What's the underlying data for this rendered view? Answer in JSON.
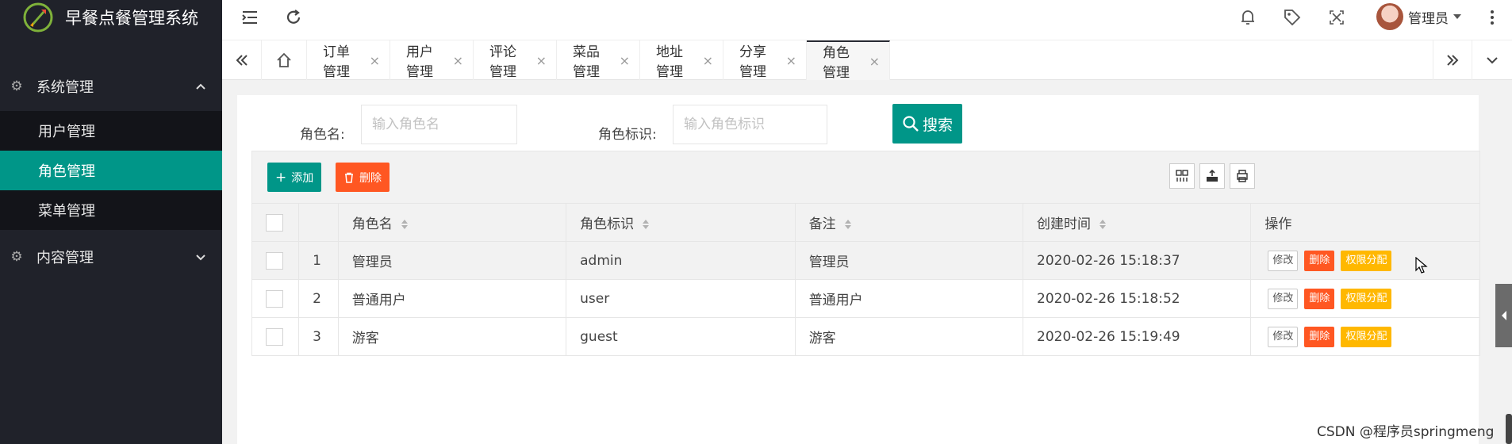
{
  "app": {
    "title": "早餐点餐管理系统"
  },
  "sidebar": {
    "groups": [
      {
        "label": "系统管理",
        "icon": "gear-icon",
        "expanded": true,
        "items": [
          {
            "label": "用户管理"
          },
          {
            "label": "角色管理",
            "active": true
          },
          {
            "label": "菜单管理"
          }
        ]
      },
      {
        "label": "内容管理",
        "icon": "gear-icon",
        "expanded": false
      }
    ]
  },
  "header": {
    "user_name": "管理员",
    "icons": [
      "menu-toggle-icon",
      "refresh-icon",
      "bell-icon",
      "tag-icon",
      "fullscreen-icon",
      "more-icon"
    ]
  },
  "tabs": {
    "items": [
      {
        "label": "订单管理"
      },
      {
        "label": "用户管理"
      },
      {
        "label": "评论管理"
      },
      {
        "label": "菜品管理"
      },
      {
        "label": "地址管理"
      },
      {
        "label": "分享管理"
      },
      {
        "label": "角色管理",
        "active": true
      }
    ],
    "close_glyph": "×"
  },
  "search": {
    "role_name_label": "角色名:",
    "role_name_placeholder": "输入角色名",
    "role_key_label": "角色标识:",
    "role_key_placeholder": "输入角色标识",
    "button_label": "搜索"
  },
  "toolbar": {
    "add_label": "添加",
    "delete_label": "删除"
  },
  "table": {
    "columns": [
      "角色名",
      "角色标识",
      "备注",
      "创建时间",
      "操作"
    ],
    "rows": [
      {
        "index": "1",
        "name": "管理员",
        "key": "admin",
        "remark": "管理员",
        "created": "2020-02-26 15:18:37"
      },
      {
        "index": "2",
        "name": "普通用户",
        "key": "user",
        "remark": "普通用户",
        "created": "2020-02-26 15:18:52"
      },
      {
        "index": "3",
        "name": "游客",
        "key": "guest",
        "remark": "游客",
        "created": "2020-02-26 15:19:49"
      }
    ],
    "actions": {
      "edit": "修改",
      "delete": "删除",
      "permission": "权限分配"
    }
  },
  "colors": {
    "primary": "#009688",
    "danger": "#ff5722",
    "warning": "#ffb800",
    "sidebar_bg": "#20222a"
  },
  "watermark": "CSDN @程序员springmeng"
}
